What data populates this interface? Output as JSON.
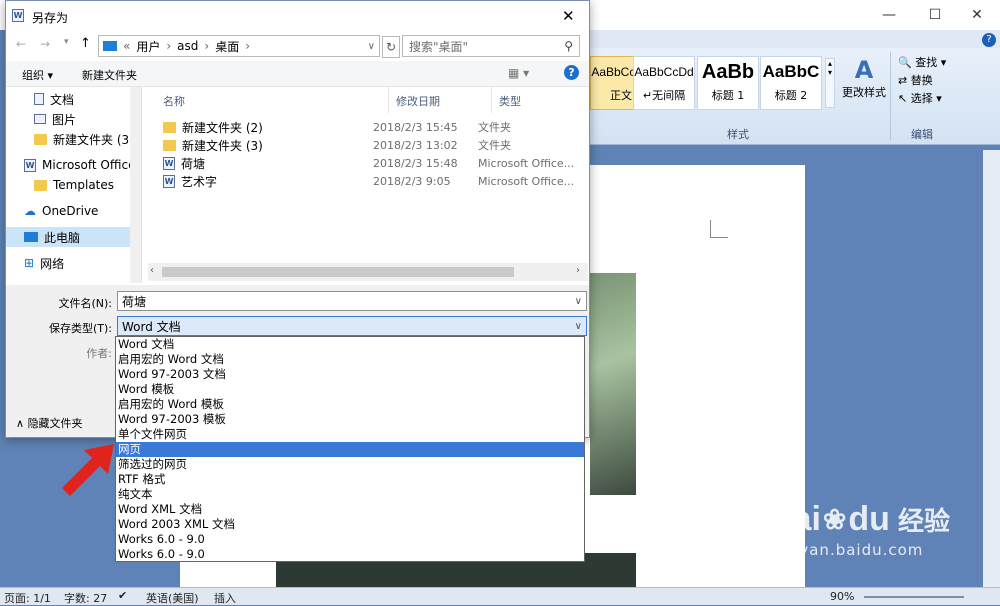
{
  "word": {
    "window_buttons": [
      "—",
      "☐",
      "✕"
    ],
    "styles": [
      {
        "preview": "AaBbCcDd",
        "name": "正文"
      },
      {
        "preview": "AaBbCcDd",
        "name": "↵无间隔"
      },
      {
        "preview": "AaBb",
        "name": "标题 1"
      },
      {
        "preview": "AaBbC",
        "name": "标题 2"
      }
    ],
    "change_styles": "更改样式",
    "styles_group": "样式",
    "edit_items": [
      "查找 ▾",
      "替换",
      "选择 ▾"
    ],
    "edit_group": "编辑",
    "status": {
      "page": "页面: 1/1",
      "words": "字数: 27",
      "lang": "英语(美国)",
      "mode": "插入",
      "zoom": "90%"
    }
  },
  "dialog": {
    "title": "另存为",
    "close": "✕",
    "address": {
      "segments": [
        "«",
        "用户",
        "›",
        "asd",
        "›",
        "桌面",
        "›"
      ]
    },
    "search_placeholder": "搜索\"桌面\"",
    "organize": "组织 ▾",
    "new_folder": "新建文件夹",
    "nav_items": [
      {
        "label": "文档",
        "icon": "documents-icon"
      },
      {
        "label": "图片",
        "icon": "pictures-icon"
      },
      {
        "label": "新建文件夹 (3)",
        "icon": "folder-icon"
      },
      {
        "label": "Microsoft Office",
        "icon": "word-icon"
      },
      {
        "label": "Templates",
        "icon": "folder-icon"
      },
      {
        "label": "OneDrive",
        "icon": "cloud-icon"
      },
      {
        "label": "此电脑",
        "icon": "computer-icon"
      },
      {
        "label": "网络",
        "icon": "network-icon"
      }
    ],
    "columns": {
      "name": "名称",
      "date": "修改日期",
      "type": "类型"
    },
    "files": [
      {
        "name": "新建文件夹 (2)",
        "date": "2018/2/3 15:45",
        "type": "文件夹",
        "kind": "folder"
      },
      {
        "name": "新建文件夹 (3)",
        "date": "2018/2/3 13:02",
        "type": "文件夹",
        "kind": "folder"
      },
      {
        "name": "荷塘",
        "date": "2018/2/3 15:48",
        "type": "Microsoft Office...",
        "kind": "doc"
      },
      {
        "name": "艺术字",
        "date": "2018/2/3 9:05",
        "type": "Microsoft Office...",
        "kind": "doc"
      }
    ],
    "filename_label": "文件名(N):",
    "filename_value": "荷塘",
    "filetype_label": "保存类型(T):",
    "filetype_value": "Word 文档",
    "author_label": "作者:",
    "hide_folders": "隐藏文件夹"
  },
  "dropdown_options": [
    "Word 文档",
    "启用宏的 Word 文档",
    "Word 97-2003 文档",
    "Word 模板",
    "启用宏的 Word 模板",
    "Word 97-2003 模板",
    "单个文件网页",
    "网页",
    "筛选过的网页",
    "RTF 格式",
    "纯文本",
    "Word XML 文档",
    "Word 2003 XML 文档",
    "Works 6.0 - 9.0",
    "Works 6.0 - 9.0"
  ],
  "selected_option_index": 7,
  "watermark": {
    "brand": "Bai",
    "brand2": "du",
    "cn": "经验",
    "url": "jingyan.baidu.com"
  }
}
